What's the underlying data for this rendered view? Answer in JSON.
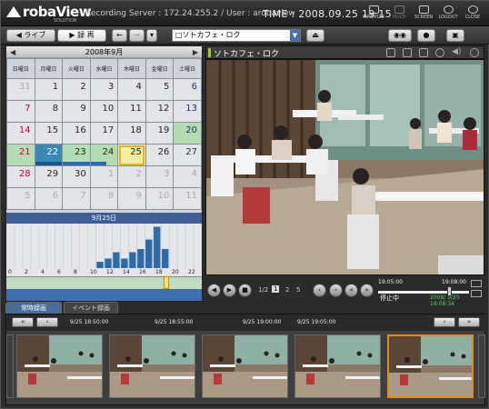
{
  "app": {
    "logo": "robaView",
    "logo_sub": "SOLUTION",
    "server_text": "Recording Server : 172.24.255.2  /  User : arobaview",
    "clock": "TIME : 2008.09.25 19 15",
    "win_buttons": [
      "MINIMIZE",
      "MULTI",
      "SCREEN",
      "LOGOUT",
      "CLOSE"
    ]
  },
  "toolbar": {
    "live_label": "◀ ライブ",
    "record_label": "▶ 録 再",
    "camera_selected": "ソトカフェ・ロク"
  },
  "calendar": {
    "month_title": "2008年9月",
    "weekdays": [
      "日曜日",
      "月曜日",
      "火曜日",
      "水曜日",
      "木曜日",
      "金曜日",
      "土曜日"
    ],
    "weeks": [
      [
        "31",
        "1",
        "2",
        "3",
        "4",
        "5",
        "6"
      ],
      [
        "7",
        "8",
        "9",
        "10",
        "11",
        "12",
        "13"
      ],
      [
        "14",
        "15",
        "16",
        "17",
        "18",
        "19",
        "20"
      ],
      [
        "21",
        "22",
        "23",
        "24",
        "25",
        "26",
        "27"
      ],
      [
        "28",
        "29",
        "30",
        "1",
        "2",
        "3",
        "4"
      ],
      [
        "5",
        "6",
        "7",
        "8",
        "9",
        "10",
        "11"
      ]
    ],
    "selected_day": "25",
    "day_title": "9月25日",
    "hour_ticks": [
      "0",
      "2",
      "4",
      "6",
      "8",
      "10",
      "12",
      "14",
      "16",
      "18",
      "20",
      "22"
    ]
  },
  "chart_data": {
    "type": "bar",
    "categories": [
      "0",
      "1",
      "2",
      "3",
      "4",
      "5",
      "6",
      "7",
      "8",
      "9",
      "10",
      "11",
      "12",
      "13",
      "14",
      "15",
      "16",
      "17",
      "18",
      "19",
      "20",
      "21",
      "22",
      "23"
    ],
    "values": [
      0,
      0,
      0,
      0,
      0,
      0,
      0,
      0,
      0,
      0,
      0,
      2,
      3,
      5,
      3,
      5,
      6,
      9,
      13,
      6,
      0,
      0,
      0,
      0
    ],
    "ylim": [
      0,
      14
    ]
  },
  "camera_view": {
    "title": "ソトカフェ・ロク"
  },
  "playback": {
    "page_label": "1/2",
    "pages": [
      "1",
      "2",
      "5"
    ],
    "time_start": "19:05:00",
    "time_end": "19:08:00",
    "status": "停止中",
    "stamp": "2008/ 9/25 19:08:34",
    "position": 0.78
  },
  "tabs": [
    "常時録画",
    "イベント録画"
  ],
  "thumbnails": {
    "times": [
      "9/25 18:50:00",
      "9/25 18:55:00",
      "9/25 19:00:00",
      "9/25 19:05:00"
    ],
    "selected_index": 4
  },
  "colors": {
    "record_green": "#b3ddb0",
    "selected_blue": "#3a88b8",
    "today_yellow": "#f3ef9e",
    "hist_blue": "#2f6aa8"
  }
}
